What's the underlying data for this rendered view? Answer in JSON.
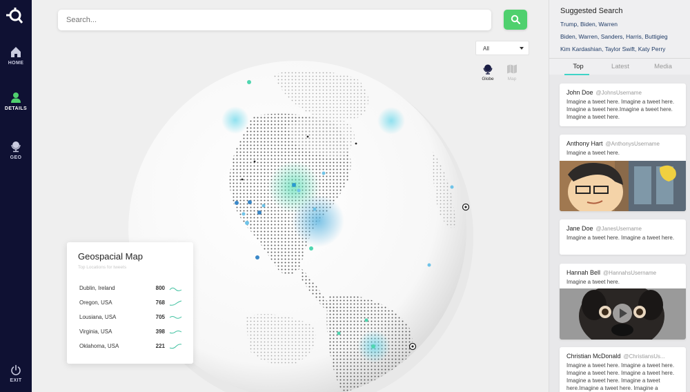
{
  "nav": {
    "items": [
      {
        "label": "HOME"
      },
      {
        "label": "DETAILS"
      },
      {
        "label": "GEO"
      },
      {
        "label": "EXIT"
      }
    ],
    "active": "DETAILS"
  },
  "search": {
    "placeholder": "Search...",
    "value": ""
  },
  "filter": {
    "selected": "All"
  },
  "view_toggle": {
    "globe_label": "Globe",
    "map_label": "Map",
    "active": "Globe"
  },
  "geo_card": {
    "title": "Geospacial Map",
    "subtitle": "Top Locations for tweets",
    "rows": [
      {
        "location": "Dublin, Ireland",
        "count": "800"
      },
      {
        "location": "Oregon, USA",
        "count": "768"
      },
      {
        "location": "Lousiana, USA",
        "count": "705"
      },
      {
        "location": "Virginia, USA",
        "count": "398"
      },
      {
        "location": "Oklahoma, USA",
        "count": "221"
      }
    ]
  },
  "suggested": {
    "title": "Suggested Search",
    "items": [
      "Trump, Biden, Warren",
      "Biden, Warren, Sanders, Harris, Buttigieg",
      "Kim Kardashian, Taylor Swift, Katy Perry"
    ]
  },
  "tabs": {
    "items": [
      "Top",
      "Latest",
      "Media"
    ],
    "active": "Top"
  },
  "tweets": [
    {
      "name": "John Doe",
      "handle": "@JohnsUsername",
      "text": "Imagine a tweet here. Imagine a tweet here. Imagine a tweet here.Imagine a tweet here. Imagine a tweet here.",
      "media": "none"
    },
    {
      "name": "Anthony Hart",
      "handle": "@AnthonysUsername",
      "text": "Imagine a tweet here.",
      "media": "image"
    },
    {
      "name": "Jane Doe",
      "handle": "@JanesUsername",
      "text": "Imagine a tweet here. Imagine a tweet here.",
      "media": "none"
    },
    {
      "name": "Hannah Bell",
      "handle": "@HannahsUsername",
      "text": "Imagine a tweet here.",
      "media": "video"
    },
    {
      "name": "Christian McDonald",
      "handle": "@ChristiansUs...",
      "text": "Imagine a tweet here. Imagine a tweet here. Imagine a tweet here. Imagine a tweet here. Imagine a tweet here. Imagine a tweet here.Imagine a tweet here. Imagine a",
      "media": "none"
    }
  ],
  "colors": {
    "nav_bg": "#0f1133",
    "accent_green": "#4fd06e",
    "accent_teal": "#3fd3c7",
    "link_blue": "#1f3b66"
  }
}
